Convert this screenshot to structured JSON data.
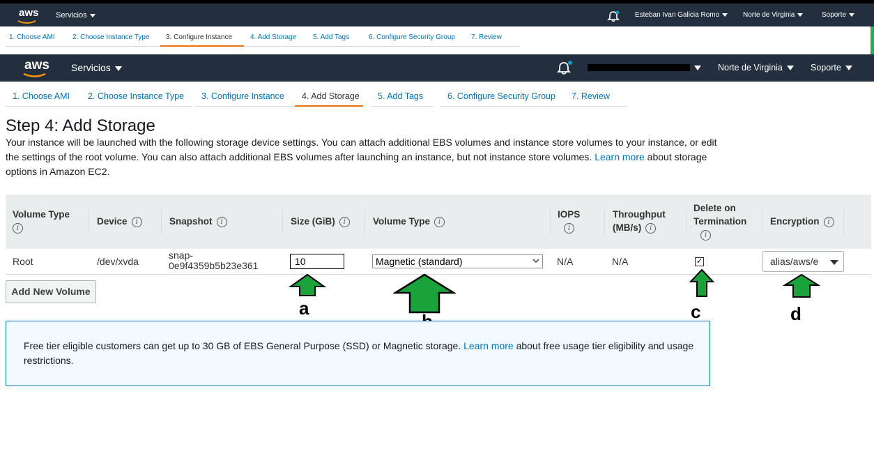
{
  "nav_small": {
    "logo": "aws",
    "services": "Servicios",
    "bell": "bell-icon",
    "user": "Esteban Ivan Galicia Romo",
    "region": "Norte de Virginia",
    "support": "Soporte"
  },
  "wizard_small": [
    "1. Choose AMI",
    "2. Choose Instance Type",
    "3. Configure Instance",
    "4. Add Storage",
    "5. Add Tags",
    "6. Configure Security Group",
    "7. Review"
  ],
  "nav_large": {
    "logo": "aws",
    "services": "Servicios",
    "region": "Norte de Virginia",
    "support": "Soporte"
  },
  "wizard_large": [
    "1. Choose AMI",
    "2. Choose Instance Type",
    "3. Configure Instance",
    "4. Add Storage",
    "5. Add Tags",
    "6. Configure Security Group",
    "7. Review"
  ],
  "page": {
    "title": "Step 4: Add Storage",
    "desc_1": "Your instance will be launched with the following storage device settings. You can attach additional EBS volumes and instance store volumes to your instance, or edit",
    "desc_2": "the settings of the root volume. You can also attach additional EBS volumes after launching an instance, but not instance store volumes.",
    "desc_link": "Learn more",
    "desc_3": "about storage",
    "desc_4": "options in Amazon EC2."
  },
  "table": {
    "headers": {
      "volume_type_1": "Volume Type",
      "device": "Device",
      "snapshot": "Snapshot",
      "size": "Size (GiB)",
      "volume_type_2": "Volume Type",
      "iops": "IOPS",
      "throughput_1": "Throughput",
      "throughput_2": "(MB/s)",
      "delete_1": "Delete on",
      "delete_2": "Termination",
      "encryption": "Encryption"
    },
    "row": {
      "volume_type": "Root",
      "device": "/dev/xvda",
      "snapshot_1": "snap-",
      "snapshot_2": "0e9f4359b5b23e361",
      "size": "10",
      "volume_type_select": "Magnetic (standard)",
      "iops": "N/A",
      "throughput": "N/A",
      "delete_on_termination": "✓",
      "encryption": "alias/aws/e"
    }
  },
  "add_volume_button": "Add New Volume",
  "alert": {
    "text_1": "Free tier eligible customers can get up to 30 GB of EBS General Purpose (SSD) or Magnetic storage.",
    "link": "Learn more",
    "text_2": "about free usage tier eligibility and usage",
    "text_3": "restrictions."
  },
  "annotations": {
    "a": "a",
    "b": "b",
    "c": "c",
    "d": "d"
  },
  "colors": {
    "nav_bg": "#232f3e",
    "link": "#0073bb",
    "active_tab": "#ec7211",
    "arrow_fill": "#1aa33a",
    "alert_border": "#0073bb"
  }
}
